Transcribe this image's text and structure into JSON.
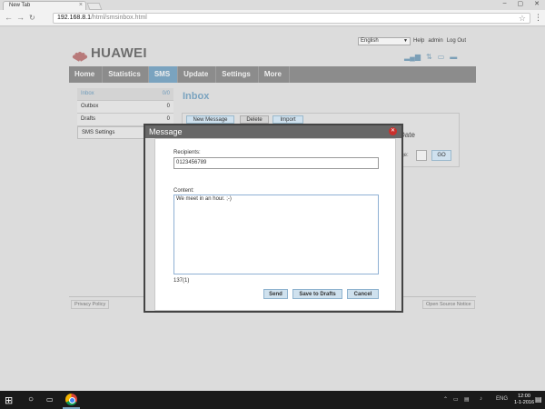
{
  "browser": {
    "tab_title": "New Tab",
    "url_host": "192.168.8.1",
    "url_path": "/html/smsinbox.html"
  },
  "header": {
    "brand": "HUAWEI",
    "language": "English",
    "links": [
      "Help",
      "admin",
      "Log Out"
    ]
  },
  "nav": {
    "items": [
      {
        "label": "Home"
      },
      {
        "label": "Statistics"
      },
      {
        "label": "SMS",
        "active": true
      },
      {
        "label": "Update"
      },
      {
        "label": "Settings"
      },
      {
        "label": "More"
      }
    ]
  },
  "sidebar": {
    "items": [
      {
        "label": "Inbox",
        "count": "0/0",
        "active": true
      },
      {
        "label": "Outbox",
        "count": "0"
      },
      {
        "label": "Drafts",
        "count": "0"
      },
      {
        "label": "SMS Settings",
        "count": ""
      }
    ]
  },
  "inbox": {
    "title": "Inbox",
    "buttons": [
      "New Message",
      "Delete",
      "Import"
    ],
    "date_header": "Date",
    "page_label": "age:",
    "go_label": "GO"
  },
  "footer": {
    "privacy": "Privacy Policy",
    "open_source": "Open Source Notice"
  },
  "modal": {
    "title": "Message",
    "recipients_label": "Recipients:",
    "recipients_value": "0123456789",
    "content_label": "Content:",
    "content_value": "We meet in an hour. ;-)",
    "counter": "137(1)",
    "send": "Send",
    "save_drafts": "Save to Drafts",
    "cancel": "Cancel"
  },
  "taskbar": {
    "time": "12:00",
    "date": "1-1-2016",
    "lang": "ENG"
  },
  "colors": {
    "accent": "#7aa3bf",
    "nav_bg": "#8c8c8c",
    "modal_header": "#676767",
    "close_red": "#c9302c"
  }
}
